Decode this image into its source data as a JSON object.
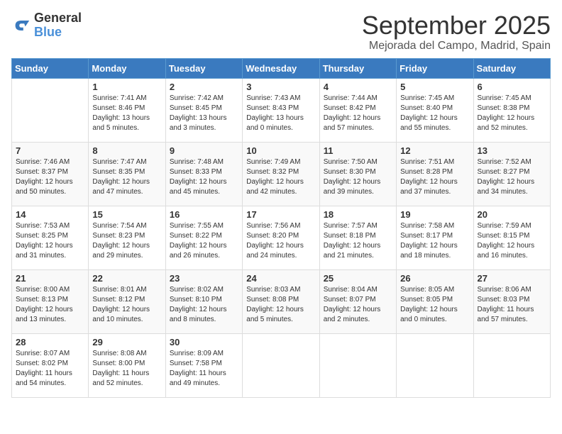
{
  "header": {
    "logo_general": "General",
    "logo_blue": "Blue",
    "month": "September 2025",
    "location": "Mejorada del Campo, Madrid, Spain"
  },
  "weekdays": [
    "Sunday",
    "Monday",
    "Tuesday",
    "Wednesday",
    "Thursday",
    "Friday",
    "Saturday"
  ],
  "weeks": [
    [
      {
        "day": "",
        "sunrise": "",
        "sunset": "",
        "daylight": ""
      },
      {
        "day": "1",
        "sunrise": "Sunrise: 7:41 AM",
        "sunset": "Sunset: 8:46 PM",
        "daylight": "Daylight: 13 hours and 5 minutes."
      },
      {
        "day": "2",
        "sunrise": "Sunrise: 7:42 AM",
        "sunset": "Sunset: 8:45 PM",
        "daylight": "Daylight: 13 hours and 3 minutes."
      },
      {
        "day": "3",
        "sunrise": "Sunrise: 7:43 AM",
        "sunset": "Sunset: 8:43 PM",
        "daylight": "Daylight: 13 hours and 0 minutes."
      },
      {
        "day": "4",
        "sunrise": "Sunrise: 7:44 AM",
        "sunset": "Sunset: 8:42 PM",
        "daylight": "Daylight: 12 hours and 57 minutes."
      },
      {
        "day": "5",
        "sunrise": "Sunrise: 7:45 AM",
        "sunset": "Sunset: 8:40 PM",
        "daylight": "Daylight: 12 hours and 55 minutes."
      },
      {
        "day": "6",
        "sunrise": "Sunrise: 7:45 AM",
        "sunset": "Sunset: 8:38 PM",
        "daylight": "Daylight: 12 hours and 52 minutes."
      }
    ],
    [
      {
        "day": "7",
        "sunrise": "Sunrise: 7:46 AM",
        "sunset": "Sunset: 8:37 PM",
        "daylight": "Daylight: 12 hours and 50 minutes."
      },
      {
        "day": "8",
        "sunrise": "Sunrise: 7:47 AM",
        "sunset": "Sunset: 8:35 PM",
        "daylight": "Daylight: 12 hours and 47 minutes."
      },
      {
        "day": "9",
        "sunrise": "Sunrise: 7:48 AM",
        "sunset": "Sunset: 8:33 PM",
        "daylight": "Daylight: 12 hours and 45 minutes."
      },
      {
        "day": "10",
        "sunrise": "Sunrise: 7:49 AM",
        "sunset": "Sunset: 8:32 PM",
        "daylight": "Daylight: 12 hours and 42 minutes."
      },
      {
        "day": "11",
        "sunrise": "Sunrise: 7:50 AM",
        "sunset": "Sunset: 8:30 PM",
        "daylight": "Daylight: 12 hours and 39 minutes."
      },
      {
        "day": "12",
        "sunrise": "Sunrise: 7:51 AM",
        "sunset": "Sunset: 8:28 PM",
        "daylight": "Daylight: 12 hours and 37 minutes."
      },
      {
        "day": "13",
        "sunrise": "Sunrise: 7:52 AM",
        "sunset": "Sunset: 8:27 PM",
        "daylight": "Daylight: 12 hours and 34 minutes."
      }
    ],
    [
      {
        "day": "14",
        "sunrise": "Sunrise: 7:53 AM",
        "sunset": "Sunset: 8:25 PM",
        "daylight": "Daylight: 12 hours and 31 minutes."
      },
      {
        "day": "15",
        "sunrise": "Sunrise: 7:54 AM",
        "sunset": "Sunset: 8:23 PM",
        "daylight": "Daylight: 12 hours and 29 minutes."
      },
      {
        "day": "16",
        "sunrise": "Sunrise: 7:55 AM",
        "sunset": "Sunset: 8:22 PM",
        "daylight": "Daylight: 12 hours and 26 minutes."
      },
      {
        "day": "17",
        "sunrise": "Sunrise: 7:56 AM",
        "sunset": "Sunset: 8:20 PM",
        "daylight": "Daylight: 12 hours and 24 minutes."
      },
      {
        "day": "18",
        "sunrise": "Sunrise: 7:57 AM",
        "sunset": "Sunset: 8:18 PM",
        "daylight": "Daylight: 12 hours and 21 minutes."
      },
      {
        "day": "19",
        "sunrise": "Sunrise: 7:58 AM",
        "sunset": "Sunset: 8:17 PM",
        "daylight": "Daylight: 12 hours and 18 minutes."
      },
      {
        "day": "20",
        "sunrise": "Sunrise: 7:59 AM",
        "sunset": "Sunset: 8:15 PM",
        "daylight": "Daylight: 12 hours and 16 minutes."
      }
    ],
    [
      {
        "day": "21",
        "sunrise": "Sunrise: 8:00 AM",
        "sunset": "Sunset: 8:13 PM",
        "daylight": "Daylight: 12 hours and 13 minutes."
      },
      {
        "day": "22",
        "sunrise": "Sunrise: 8:01 AM",
        "sunset": "Sunset: 8:12 PM",
        "daylight": "Daylight: 12 hours and 10 minutes."
      },
      {
        "day": "23",
        "sunrise": "Sunrise: 8:02 AM",
        "sunset": "Sunset: 8:10 PM",
        "daylight": "Daylight: 12 hours and 8 minutes."
      },
      {
        "day": "24",
        "sunrise": "Sunrise: 8:03 AM",
        "sunset": "Sunset: 8:08 PM",
        "daylight": "Daylight: 12 hours and 5 minutes."
      },
      {
        "day": "25",
        "sunrise": "Sunrise: 8:04 AM",
        "sunset": "Sunset: 8:07 PM",
        "daylight": "Daylight: 12 hours and 2 minutes."
      },
      {
        "day": "26",
        "sunrise": "Sunrise: 8:05 AM",
        "sunset": "Sunset: 8:05 PM",
        "daylight": "Daylight: 12 hours and 0 minutes."
      },
      {
        "day": "27",
        "sunrise": "Sunrise: 8:06 AM",
        "sunset": "Sunset: 8:03 PM",
        "daylight": "Daylight: 11 hours and 57 minutes."
      }
    ],
    [
      {
        "day": "28",
        "sunrise": "Sunrise: 8:07 AM",
        "sunset": "Sunset: 8:02 PM",
        "daylight": "Daylight: 11 hours and 54 minutes."
      },
      {
        "day": "29",
        "sunrise": "Sunrise: 8:08 AM",
        "sunset": "Sunset: 8:00 PM",
        "daylight": "Daylight: 11 hours and 52 minutes."
      },
      {
        "day": "30",
        "sunrise": "Sunrise: 8:09 AM",
        "sunset": "Sunset: 7:58 PM",
        "daylight": "Daylight: 11 hours and 49 minutes."
      },
      {
        "day": "",
        "sunrise": "",
        "sunset": "",
        "daylight": ""
      },
      {
        "day": "",
        "sunrise": "",
        "sunset": "",
        "daylight": ""
      },
      {
        "day": "",
        "sunrise": "",
        "sunset": "",
        "daylight": ""
      },
      {
        "day": "",
        "sunrise": "",
        "sunset": "",
        "daylight": ""
      }
    ]
  ]
}
